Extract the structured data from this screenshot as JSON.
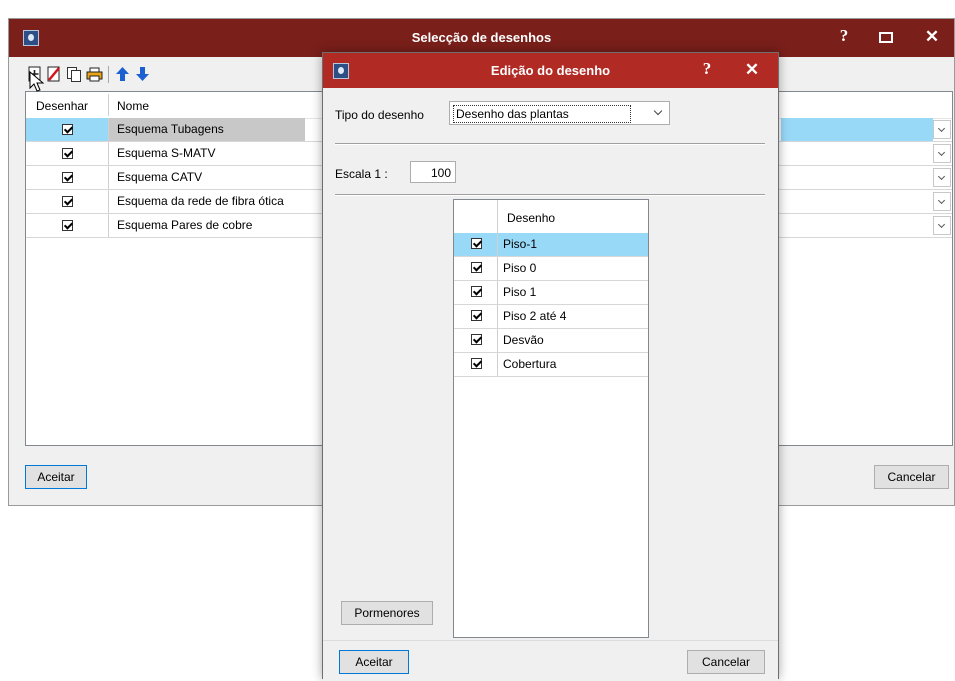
{
  "main_window": {
    "title": "Selecção de desenhos",
    "columns": {
      "draw": "Desenhar",
      "name": "Nome"
    },
    "rows": [
      {
        "name": "Esquema Tubagens",
        "checked": true,
        "selected": true
      },
      {
        "name": "Esquema S-MATV",
        "checked": true,
        "selected": false
      },
      {
        "name": "Esquema CATV",
        "checked": true,
        "selected": false
      },
      {
        "name": "Esquema da rede de fibra ótica",
        "checked": true,
        "selected": false
      },
      {
        "name": "Esquema Pares de cobre",
        "checked": true,
        "selected": false
      }
    ],
    "accept_label": "Aceitar",
    "cancel_label": "Cancelar",
    "help_glyph": "?",
    "maximize_glyph": "☐",
    "close_glyph": "✕"
  },
  "dialog": {
    "title": "Edição do desenho",
    "type_label": "Tipo do desenho",
    "type_value": "Desenho das plantas",
    "scale_label": "Escala  1 :",
    "scale_value": "100",
    "list_header": "Desenho",
    "floors": [
      {
        "name": "Piso-1",
        "checked": true,
        "selected": true
      },
      {
        "name": "Piso 0",
        "checked": true,
        "selected": false
      },
      {
        "name": "Piso 1",
        "checked": true,
        "selected": false
      },
      {
        "name": "Piso 2 até 4",
        "checked": true,
        "selected": false
      },
      {
        "name": "Desvão",
        "checked": true,
        "selected": false
      },
      {
        "name": "Cobertura",
        "checked": true,
        "selected": false
      }
    ],
    "details_label": "Pormenores",
    "accept_label": "Aceitar",
    "cancel_label": "Cancelar",
    "help_glyph": "?",
    "close_glyph": "✕"
  },
  "colors": {
    "title_main": "#7a1f1a",
    "title_dialog": "#b12a24",
    "selection_blue": "#99d9f8",
    "selection_gray": "#c8c8c8"
  }
}
